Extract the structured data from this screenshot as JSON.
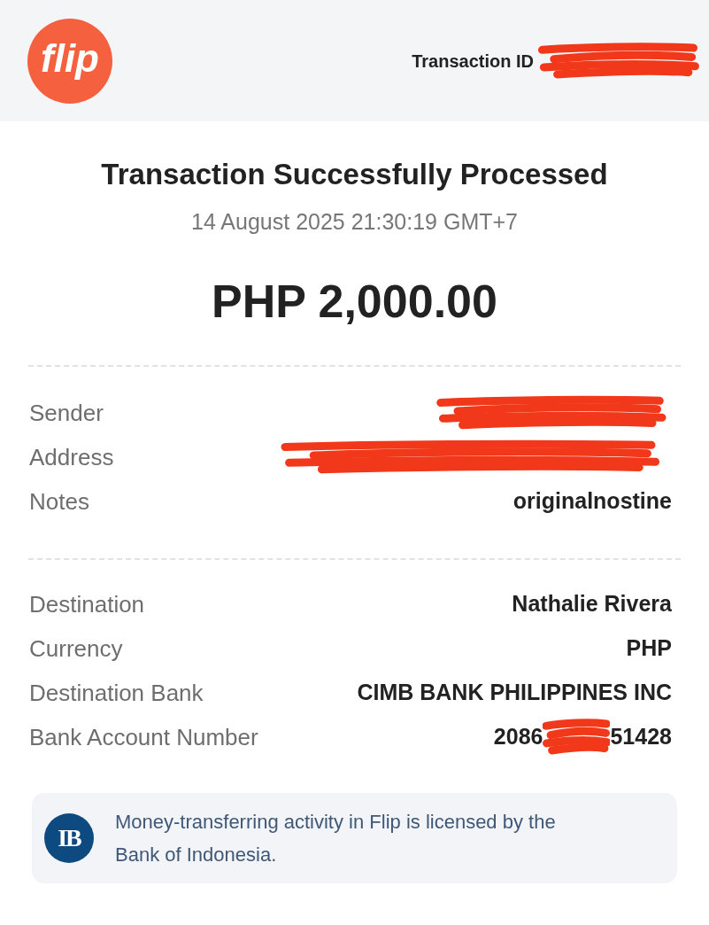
{
  "header": {
    "logo": "flip",
    "transaction_id_label": "Transaction ID",
    "transaction_id_redacted": true
  },
  "summary": {
    "title": "Transaction Successfully Processed",
    "timestamp": "14 August 2025 21:30:19 GMT+7",
    "amount": "PHP 2,000.00"
  },
  "sender_details": [
    {
      "label": "Sender",
      "redacted": true
    },
    {
      "label": "Address",
      "redacted": true
    },
    {
      "label": "Notes",
      "value": "originalnostine",
      "redacted": false
    }
  ],
  "destination_details": [
    {
      "label": "Destination",
      "value": "Nathalie Rivera",
      "redacted": false
    },
    {
      "label": "Currency",
      "value": "PHP",
      "redacted": false
    },
    {
      "label": "Destination Bank",
      "value": "CIMB BANK PHILIPPINES INC",
      "redacted": false
    },
    {
      "label": "Bank Account Number",
      "value": "2086",
      "value_end": "51428",
      "redacted": true
    }
  ],
  "notice": {
    "logo_text": "IB",
    "text": "Money-transferring activity in Flip is licensed by the Bank of Indonesia."
  }
}
